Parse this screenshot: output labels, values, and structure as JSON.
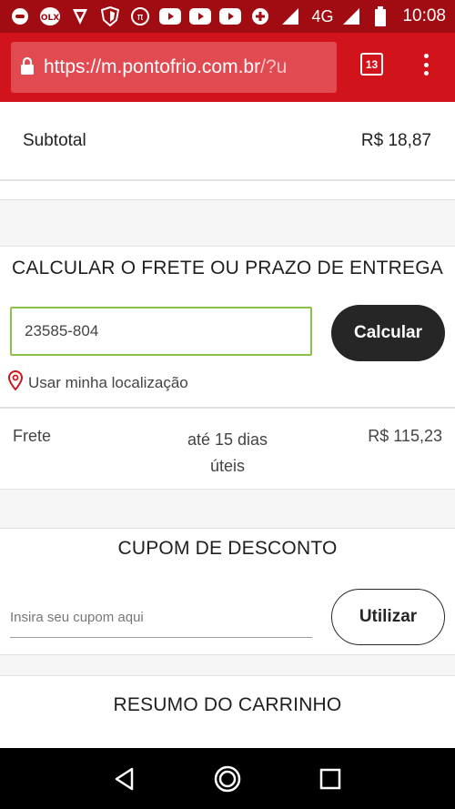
{
  "status_bar": {
    "icons": [
      "whatsapp-icon",
      "olx-icon",
      "vpn-icon",
      "shield-icon",
      "pi-icon",
      "youtube-icon",
      "youtube-icon",
      "youtube-icon",
      "mdroid-icon",
      "signal-icon"
    ],
    "network": "4G",
    "time": "10:08"
  },
  "browser": {
    "url_main": "https://m.pontofrio.com.br",
    "url_rest": "/?u",
    "tab_count": "13"
  },
  "summary": {
    "subtotal_label": "Subtotal",
    "subtotal_value": "R$ 18,87"
  },
  "shipping": {
    "title": "CALCULAR O FRETE OU PRAZO DE ENTREGA",
    "cep_value": "23585-804",
    "calculate_label": "Calcular",
    "location_label": "Usar minha localização",
    "frete_label": "Frete",
    "frete_deadline_line1": "até 15 dias",
    "frete_deadline_line2": "úteis",
    "frete_value": "R$ 115,23"
  },
  "coupon": {
    "title": "CUPOM DE DESCONTO",
    "placeholder": "Insira seu cupom aqui",
    "apply_label": "Utilizar"
  },
  "cart_summary": {
    "title": "RESUMO DO CARRINHO"
  },
  "colors": {
    "status_bar": "#a10b12",
    "toolbar": "#d1141c",
    "input_border": "#8bc34a",
    "button_dark": "#262626"
  }
}
